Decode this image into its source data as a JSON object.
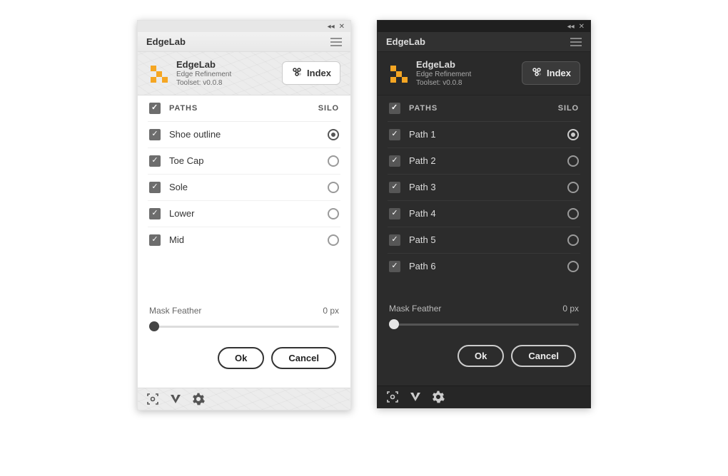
{
  "common": {
    "brand_title": "EdgeLab",
    "brand_subtitle": "Edge Refinement",
    "header_paths": "PATHS",
    "header_silo": "SILO",
    "index_label": "Index",
    "mask_label": "Mask Feather",
    "mask_value": "0 px",
    "ok_label": "Ok",
    "cancel_label": "Cancel",
    "accent_color": "#f5a623"
  },
  "light": {
    "tab_title": "EdgeLab",
    "version": "Toolset: v0.0.8",
    "paths": [
      {
        "name": "Shoe outline",
        "checked": true,
        "silo": true
      },
      {
        "name": "Toe Cap",
        "checked": true,
        "silo": false
      },
      {
        "name": "Sole",
        "checked": true,
        "silo": false
      },
      {
        "name": "Lower",
        "checked": true,
        "silo": false
      },
      {
        "name": "Mid",
        "checked": true,
        "silo": false
      }
    ]
  },
  "dark": {
    "tab_title": "EdgeLab",
    "version": "Toolset: v0.0.8",
    "paths": [
      {
        "name": "Path 1",
        "checked": true,
        "silo": true
      },
      {
        "name": "Path 2",
        "checked": true,
        "silo": false
      },
      {
        "name": "Path 3",
        "checked": true,
        "silo": false
      },
      {
        "name": "Path 4",
        "checked": true,
        "silo": false
      },
      {
        "name": "Path 5",
        "checked": true,
        "silo": false
      },
      {
        "name": "Path 6",
        "checked": true,
        "silo": false
      }
    ]
  }
}
